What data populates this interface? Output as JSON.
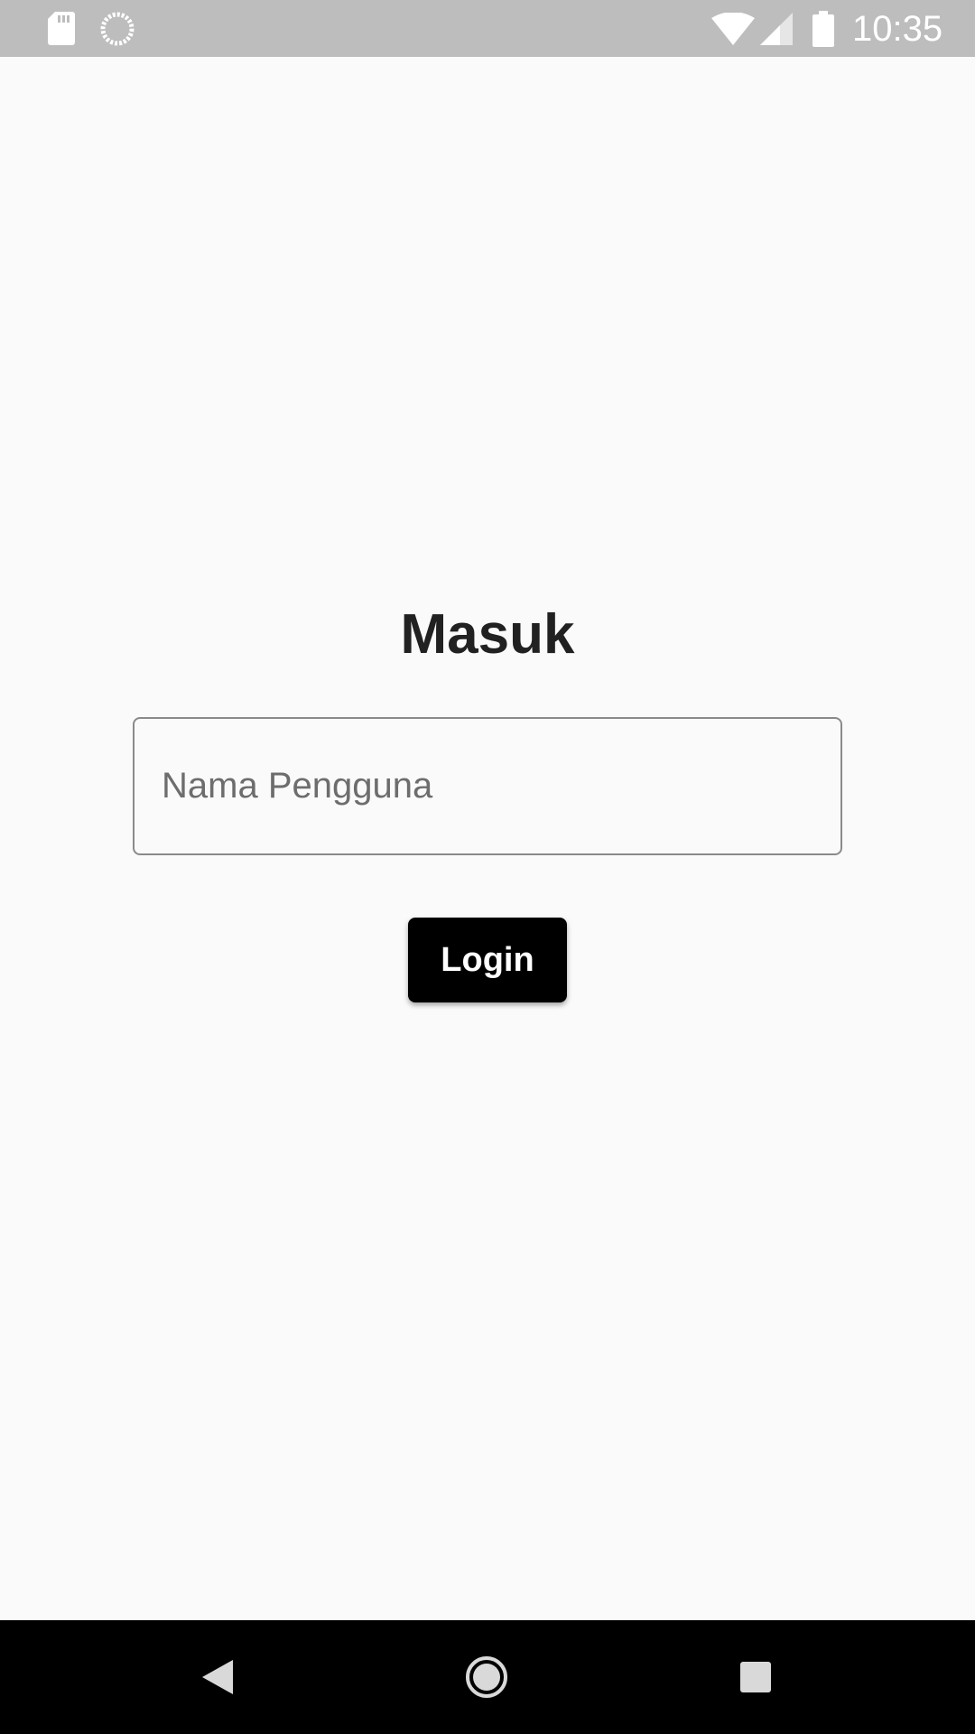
{
  "status_bar": {
    "time": "10:35",
    "icons": [
      "sd-card-icon",
      "sync-icon",
      "wifi-icon",
      "cell-signal-icon",
      "battery-icon"
    ]
  },
  "login": {
    "title": "Masuk",
    "username_placeholder": "Nama Pengguna",
    "username_value": "",
    "login_label": "Login"
  },
  "nav_bar": {
    "icons": [
      "back-icon",
      "home-icon",
      "recents-icon"
    ]
  },
  "colors": {
    "status_bar_bg": "#bdbdbd",
    "page_bg": "#fafafa",
    "title_text": "#212121",
    "button_bg": "#000000",
    "button_text": "#ffffff",
    "nav_bar_bg": "#000000"
  }
}
